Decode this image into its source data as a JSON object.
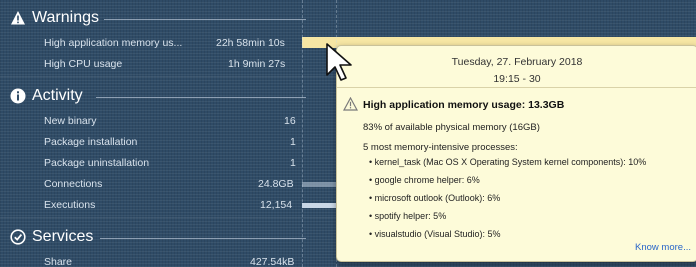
{
  "sections": {
    "warnings": {
      "title": "Warnings",
      "icon": "warning-icon",
      "rows": [
        {
          "label": "High application memory us...",
          "value": "22h 58min 10s"
        },
        {
          "label": "High CPU usage",
          "value": "1h 9min 27s"
        }
      ]
    },
    "activity": {
      "title": "Activity",
      "icon": "info-icon",
      "rows": [
        {
          "label": "New binary",
          "value": "16"
        },
        {
          "label": "Package installation",
          "value": "1"
        },
        {
          "label": "Package uninstallation",
          "value": "1"
        },
        {
          "label": "Connections",
          "value": "24.8GB"
        },
        {
          "label": "Executions",
          "value": "12,154"
        }
      ]
    },
    "services": {
      "title": "Services",
      "icon": "check-circle-icon",
      "rows": [
        {
          "label": "Share",
          "value": "427.54kB"
        }
      ]
    }
  },
  "tooltip": {
    "date": "Tuesday, 27. February 2018",
    "time": "19:15 - 30",
    "title": "High application memory usage: 13.3GB",
    "summary": "83% of available physical memory (16GB)",
    "processes_heading": "5 most memory-intensive processes:",
    "processes": [
      "kernel_task (Mac OS X Operating System kernel components): 10%",
      "google chrome helper: 6%",
      "microsoft outlook (Outlook): 6%",
      "spotify helper: 5%",
      "visualstudio (Visual Studio): 5%"
    ],
    "more_link": "Know more..."
  },
  "colors": {
    "background": "#2f4b66",
    "highlight_bar": "#f6e6a4",
    "tooltip_bg": "#fdfbd9",
    "link": "#2a66c9"
  }
}
